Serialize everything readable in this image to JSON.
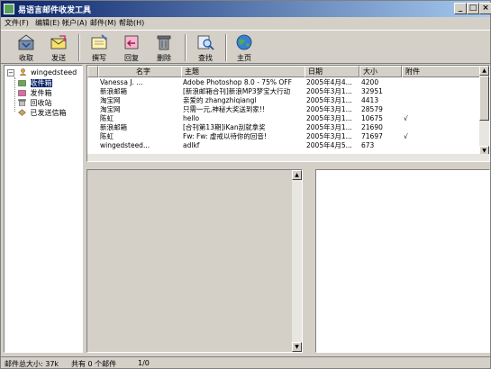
{
  "window": {
    "title": "易语言邮件收发工具",
    "controls": {
      "minimize": "_",
      "maximize": "□",
      "close": "×"
    }
  },
  "menu": [
    {
      "label": "文件(F)"
    },
    {
      "label": "编辑(E)"
    },
    {
      "label": "帐户(A)"
    },
    {
      "label": "邮件(M)"
    },
    {
      "label": "帮助(H)"
    }
  ],
  "toolbar": [
    {
      "label": "收取",
      "icon": "receive-mail-icon"
    },
    {
      "label": "发送",
      "icon": "send-mail-icon"
    },
    {
      "label": "撰写",
      "icon": "compose-icon"
    },
    {
      "label": "回复",
      "icon": "reply-icon"
    },
    {
      "label": "删除",
      "icon": "delete-icon"
    },
    {
      "label": "查找",
      "icon": "find-icon"
    },
    {
      "label": "主页",
      "icon": "homepage-icon"
    }
  ],
  "tree": {
    "account": "wingedsteed",
    "folders": [
      {
        "label": "收件箱",
        "icon": "inbox-icon"
      },
      {
        "label": "发件箱",
        "icon": "outbox-icon"
      },
      {
        "label": "回收站",
        "icon": "recycle-bin-icon"
      },
      {
        "label": "已发送信箱",
        "icon": "sent-box-icon"
      }
    ]
  },
  "list": {
    "columns": [
      "名字",
      "主题",
      "日期",
      "大小",
      "附件"
    ],
    "rows": [
      {
        "name": "Vanessa J. ...",
        "subject": "Adobe Photoshop 8.0 - 75% OFF",
        "date": "2005年4月4...",
        "size": "4200",
        "attach": ""
      },
      {
        "name": "新浪邮箱",
        "subject": "[新浪邮箱合刊]新浪MP3梦宝大行动",
        "date": "2005年3月1...",
        "size": "32951",
        "attach": ""
      },
      {
        "name": "淘宝网",
        "subject": "亲爱的 zhangzhiqiangl",
        "date": "2005年3月1...",
        "size": "4413",
        "attach": ""
      },
      {
        "name": "淘宝网",
        "subject": "只需一元,神秘大奖送到家!!",
        "date": "2005年3月1...",
        "size": "28579",
        "attach": ""
      },
      {
        "name": "陈虹",
        "subject": "hello",
        "date": "2005年3月1...",
        "size": "10675",
        "attach": "√"
      },
      {
        "name": "新浪邮箱",
        "subject": "[合刊第13期]iKan刮就拿奖",
        "date": "2005年3月1...",
        "size": "21690",
        "attach": ""
      },
      {
        "name": "陈虹",
        "subject": "Fw: Fw: 虚戒以待你的回音!",
        "date": "2005年3月1...",
        "size": "71697",
        "attach": "√"
      },
      {
        "name": "wingedsteed...",
        "subject": "adlkf",
        "date": "2005年4月5...",
        "size": "673",
        "attach": ""
      }
    ]
  },
  "status": {
    "total_size": "邮件总大小: 37k",
    "count": "共有 0 个邮件",
    "page": "1/0"
  }
}
